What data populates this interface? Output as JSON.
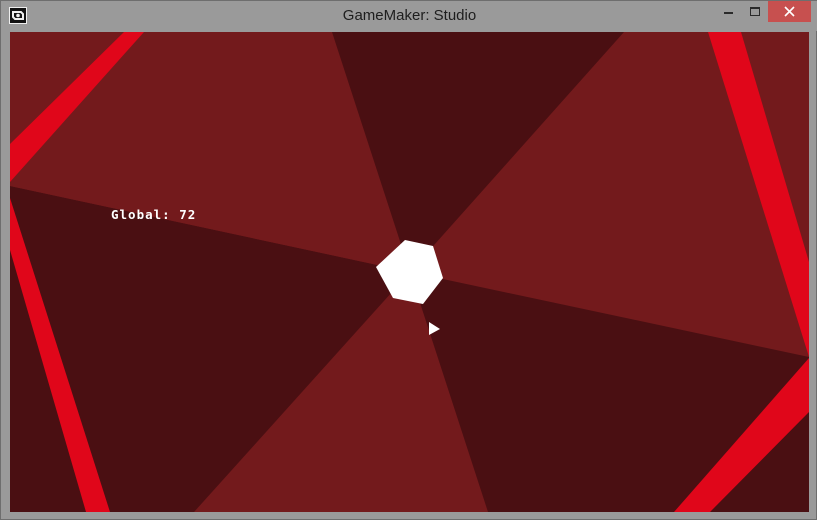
{
  "window": {
    "title": "GameMaker: Studio",
    "icon": "gamemaker-icon",
    "controls": [
      "minimize",
      "maximize",
      "close"
    ]
  },
  "game": {
    "hud_label": "Global",
    "hud_value": "72"
  },
  "colors": {
    "background_dark": "#4a0f12",
    "background_light": "#731a1c",
    "wall": "#e0061a",
    "player": "#ffffff",
    "center": "#ffffff"
  }
}
